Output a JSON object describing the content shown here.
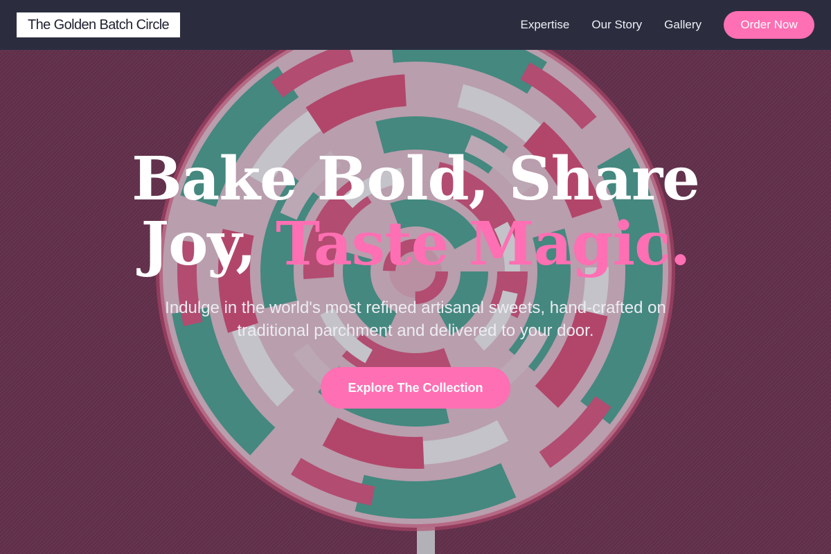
{
  "nav": {
    "brand": "The Golden Batch Circle",
    "links": [
      "Expertise",
      "Our Story",
      "Gallery"
    ],
    "order_button": "Order Now"
  },
  "hero": {
    "headline_line1": "Bake Bold, Share",
    "headline_line2_white": "Joy, ",
    "headline_line2_accent": "Taste Magic.",
    "subtitle": "Indulge in the world's most refined artisanal sweets, hand-crafted on traditional parchment and delivered to your door.",
    "cta_label": "Explore The Collection",
    "background_image": "swirl-lollipop"
  },
  "colors": {
    "nav_background": "#2b2d3f",
    "accent_pink": "#ff6fb3",
    "hero_background": "#7b3553",
    "brand_background": "#ffffff"
  }
}
